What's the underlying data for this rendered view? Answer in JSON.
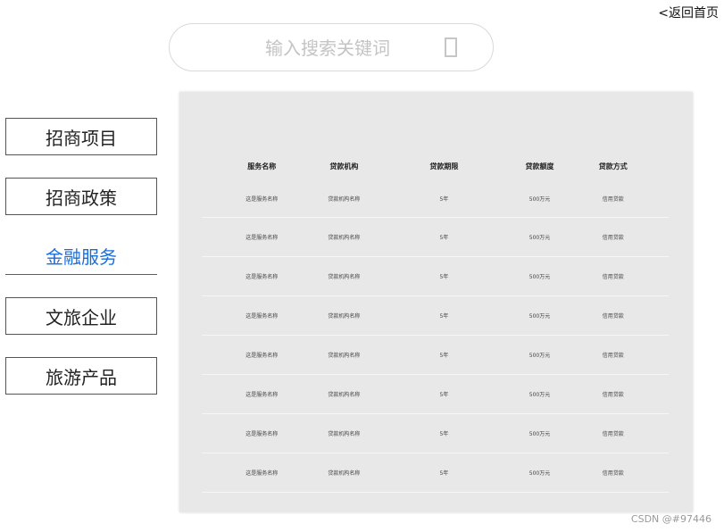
{
  "header": {
    "back_label": "<返回首页"
  },
  "search": {
    "placeholder": "输入搜索关键词",
    "value": ""
  },
  "nav": {
    "items": [
      {
        "label": "招商项目",
        "active": false
      },
      {
        "label": "招商政策",
        "active": false
      },
      {
        "label": "金融服务",
        "active": true
      },
      {
        "label": "文旅企业",
        "active": false
      },
      {
        "label": "旅游产品",
        "active": false
      }
    ]
  },
  "table": {
    "columns": [
      "服务名称",
      "贷款机构",
      "贷款期限",
      "贷款额度",
      "贷款方式"
    ],
    "rows": [
      [
        "这是服务名称",
        "贷款机构名称",
        "5年",
        "500万元",
        "信用贷款"
      ],
      [
        "这是服务名称",
        "贷款机构名称",
        "5年",
        "500万元",
        "信用贷款"
      ],
      [
        "这是服务名称",
        "贷款机构名称",
        "5年",
        "500万元",
        "信用贷款"
      ],
      [
        "这是服务名称",
        "贷款机构名称",
        "5年",
        "500万元",
        "信用贷款"
      ],
      [
        "这是服务名称",
        "贷款机构名称",
        "5年",
        "500万元",
        "信用贷款"
      ],
      [
        "这是服务名称",
        "贷款机构名称",
        "5年",
        "500万元",
        "信用贷款"
      ],
      [
        "这是服务名称",
        "贷款机构名称",
        "5年",
        "500万元",
        "信用贷款"
      ],
      [
        "这是服务名称",
        "贷款机构名称",
        "5年",
        "500万元",
        "信用贷款"
      ]
    ]
  },
  "watermark": "CSDN @#97446",
  "colors": {
    "accent": "#1a6dd6",
    "panel_bg": "#e8e8e8"
  }
}
